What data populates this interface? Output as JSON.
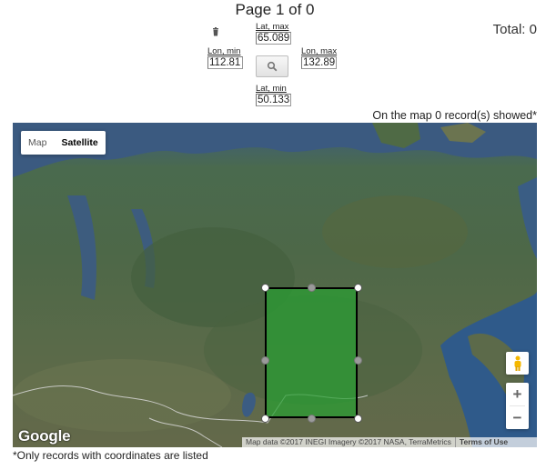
{
  "pager": {
    "text": "Page 1 of 0"
  },
  "total": {
    "text": "Total: 0"
  },
  "filters": {
    "lat_max": {
      "label": "Lat, max",
      "value": "65.089"
    },
    "lon_min": {
      "label": "Lon, min",
      "value": "112.81"
    },
    "lon_max": {
      "label": "Lon, max",
      "value": "132.89"
    },
    "lat_min": {
      "label": "Lat, min",
      "value": "50.133"
    }
  },
  "icons": {
    "delete": "trash-icon",
    "search": "magnifier-icon",
    "street_view": "pegman-icon"
  },
  "status": {
    "on_map": "On the map 0 record(s) showed*"
  },
  "map": {
    "type_control": {
      "map_label": "Map",
      "satellite_label": "Satellite",
      "selected": "Satellite"
    },
    "zoom_in": "+",
    "zoom_out": "−",
    "logo": "Google",
    "attribution": "Map data ©2017 INEGI Imagery ©2017 NASA, TerraMetrics",
    "terms": "Terms of Use",
    "selection_color": "#2ea043"
  },
  "footnote": "*Only records with coordinates are listed"
}
